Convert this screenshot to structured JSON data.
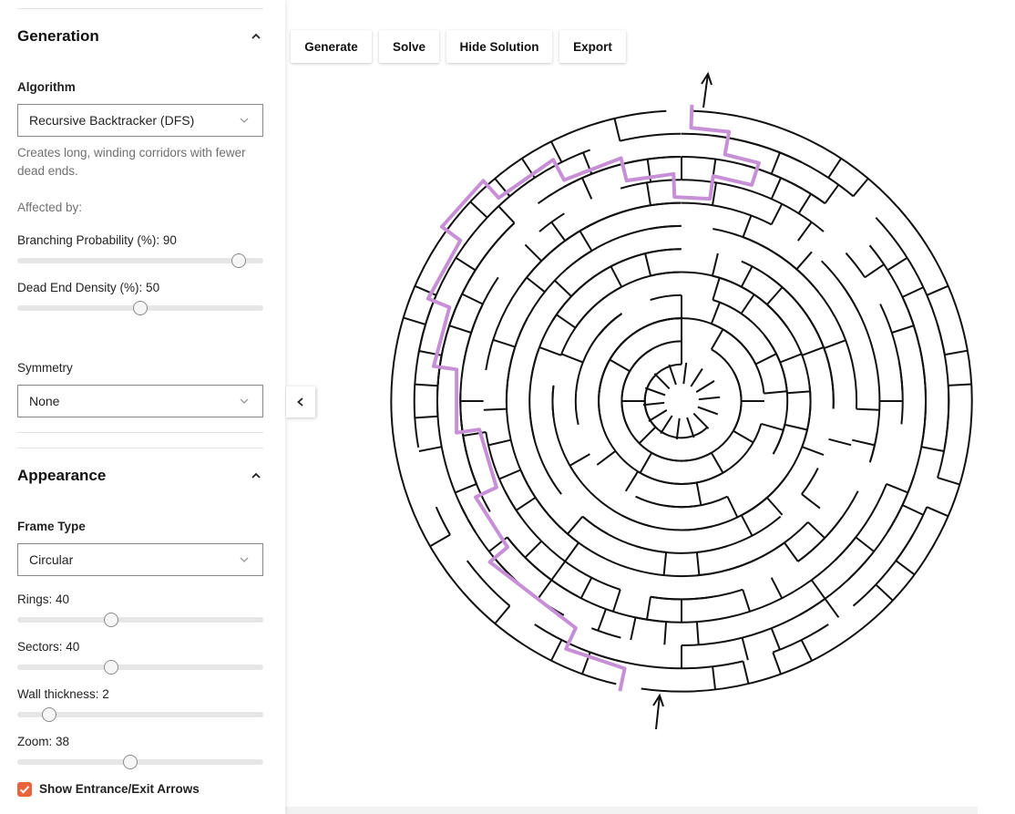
{
  "toolbar": {
    "generate": "Generate",
    "solve": "Solve",
    "hide_solution": "Hide Solution",
    "export": "Export"
  },
  "sidebar": {
    "generation": {
      "title": "Generation",
      "algorithm_label": "Algorithm",
      "algorithm_value": "Recursive Backtracker (DFS)",
      "algorithm_description": "Creates long, winding corridors with fewer dead ends.",
      "affected_by": "Affected by:",
      "branching_label": "Branching Probability (%): 90",
      "branching_value": 90,
      "dead_end_label": "Dead End Density (%): 50",
      "dead_end_value": 50,
      "symmetry_label": "Symmetry",
      "symmetry_value": "None"
    },
    "appearance": {
      "title": "Appearance",
      "frame_type_label": "Frame Type",
      "frame_type_value": "Circular",
      "rings_label": "Rings: 40",
      "rings_fraction": 0.38,
      "sectors_label": "Sectors: 40",
      "sectors_fraction": 0.38,
      "wall_label": "Wall thickness: 2",
      "wall_fraction": 0.13,
      "zoom_label": "Zoom: 38",
      "zoom_fraction": 0.46,
      "show_arrows_label": "Show Entrance/Exit Arrows",
      "show_arrows_checked": true
    }
  },
  "maze": {
    "frame": "circular",
    "wall_color": "#111111",
    "solution_color": "#c68fd6",
    "solution_visible": true
  },
  "icons": {
    "collapse": "chevron-up-icon",
    "dropdown": "chevron-down-icon",
    "panel_toggle": "chevron-left-icon",
    "check": "checkmark-icon",
    "arrow": "arrow-up-icon"
  }
}
